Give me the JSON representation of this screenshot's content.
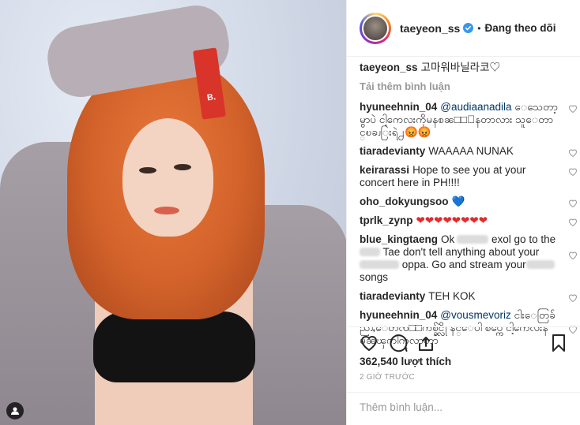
{
  "post": {
    "photo_text": "B.",
    "header": {
      "username": "taeyeon_ss",
      "verified_icon": "verified-badge-icon",
      "separator": "•",
      "follow_status": "Đang theo dõi"
    },
    "caption": {
      "username": "taeyeon_ss",
      "text": "고마워바닐라코♡"
    },
    "load_more": "Tải thêm bình luận",
    "comments": [
      {
        "user": "hyuneehnin_04",
        "mention": "@audiaanadila",
        "text": " ေသေတာ့မွာပဲ ငါ့ကေလးကိုမနစၼ□□ေနတာလား သူေတာင္ၿခၪြးရဲ႕",
        "emoji": "😡😡"
      },
      {
        "user": "tiaradevianty",
        "text": "WAAAAA NUNAK"
      },
      {
        "user": "keirarassi",
        "text": "Hope to see you at your concert here in PH!!!!"
      },
      {
        "user": "oho_dokyungsoo",
        "text": "💙"
      },
      {
        "user": "tprlk_zynp",
        "text": "❤❤❤❤❤❤❤❤"
      },
      {
        "user": "blue_kingtaeng",
        "text1": "Ok",
        "text2": " exol go to the",
        "text3": " Tae don't tell anything about your",
        "text4": " oppa. Go and stream your",
        "text5": " songs"
      },
      {
        "user": "tiaradevianty",
        "text": "TEH KOK"
      },
      {
        "user": "hyuneehnin_04",
        "mention": "@vousmevoriz",
        "text": " ငါးေတြခ်ညၪႇေတၸ□□ကစ္ခ်င္လိုဲ နင္ေပါ စပ္ကေ ငါ့ကေလးနမၼၾကါကုလာတာ"
      }
    ],
    "likes": "362,540 lượt thích",
    "time": "2 GIỜ TRƯỚC",
    "comment_placeholder": "Thêm bình luận..."
  }
}
